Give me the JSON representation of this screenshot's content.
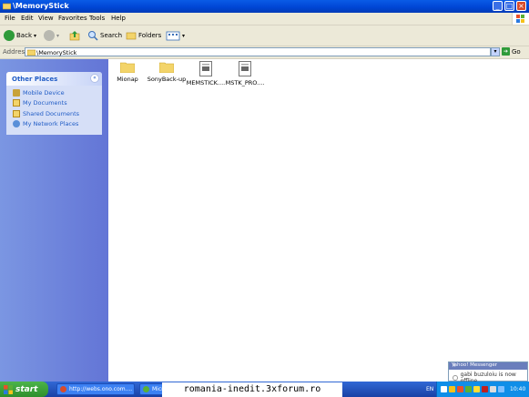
{
  "window": {
    "title": "\\MemoryStick"
  },
  "menu": [
    "File",
    "Edit",
    "View",
    "Favorites",
    "Tools",
    "Help"
  ],
  "toolbar": {
    "back": "Back",
    "search": "Search",
    "folders": "Folders"
  },
  "address": {
    "label": "Address",
    "value": "\\MemoryStick",
    "go": "Go"
  },
  "other_places": {
    "title": "Other Places",
    "items": [
      "Mobile Device",
      "My Documents",
      "Shared Documents",
      "My Network Places"
    ]
  },
  "files": [
    {
      "name": "Mionap",
      "type": "folder"
    },
    {
      "name": "SonyBack-up",
      "type": "folder"
    },
    {
      "name": "MEMSTICK....",
      "type": "file"
    },
    {
      "name": "MSTK_PRO....",
      "type": "file"
    }
  ],
  "messenger": {
    "title": "Yahoo! Messenger",
    "message": "gabi buzuloiu is now offline"
  },
  "taskbar": {
    "start": "start",
    "tasks": [
      "http://webs.ono.com....",
      "Micr"
    ],
    "watermark": "romania-inedit.3xforum.ro",
    "lang": "EN",
    "clock": "10:40"
  }
}
